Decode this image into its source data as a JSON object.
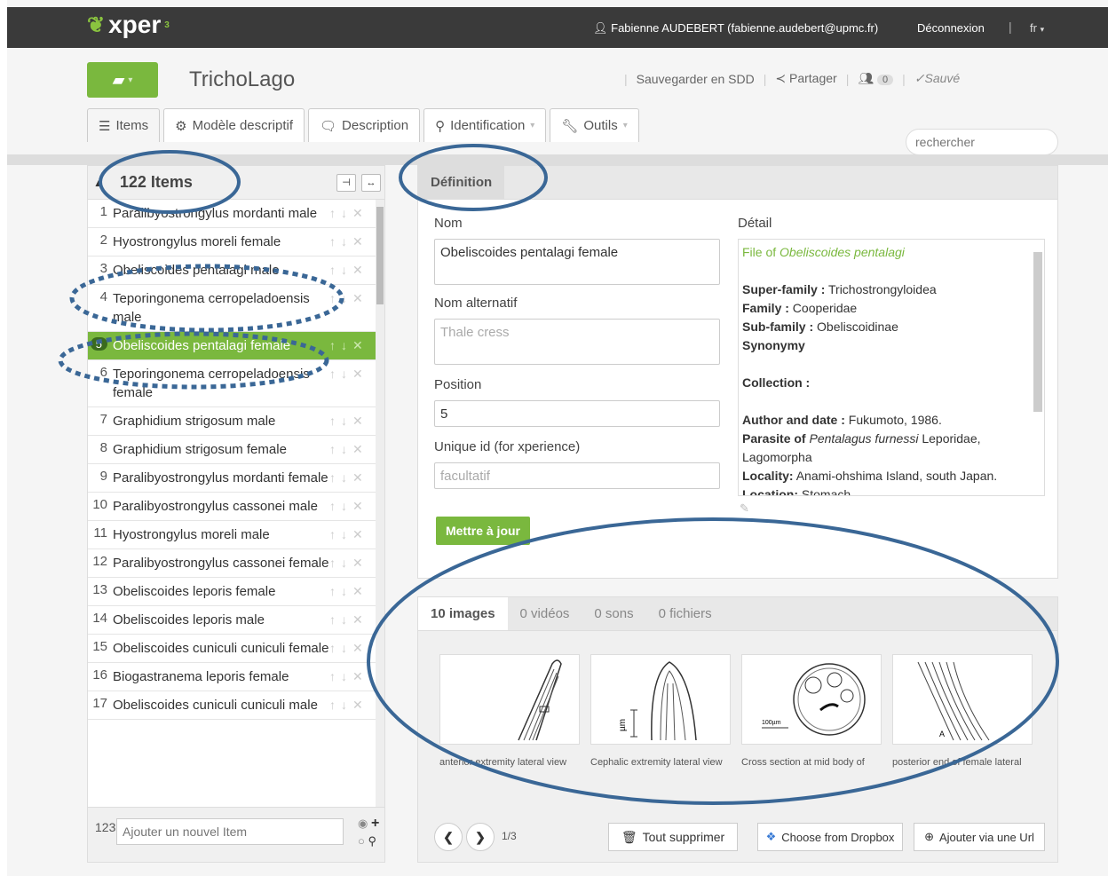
{
  "topbar": {
    "user": "Fabienne AUDEBERT (fabienne.audebert@upmc.fr)",
    "logout": "Déconnexion",
    "separator": "|",
    "lang": "fr"
  },
  "header": {
    "title": "TrichoLago",
    "save_sdd": "Sauvegarder en SDD",
    "share": "Partager",
    "collab_count": "0",
    "saved": "Sauvé"
  },
  "tabs": [
    "Items",
    "Modèle descriptif",
    "Description",
    "Identification",
    "Outils"
  ],
  "search": {
    "placeholder": "rechercher"
  },
  "items": {
    "count": "122 Items",
    "add_num": "123",
    "add_placeholder": "Ajouter un nouvel Item"
  },
  "item_rows": [
    {
      "num": "1",
      "name": "Paralibyostrongylus mordanti male"
    },
    {
      "num": "2",
      "name": "Hyostrongylus moreli female"
    },
    {
      "num": "3",
      "name": "Obeliscoides pentalagi male"
    },
    {
      "num": "4",
      "name": "Teporingonema cerropeladoensis male"
    },
    {
      "num": "5",
      "name": "Obeliscoides pentalagi female"
    },
    {
      "num": "6",
      "name": "Teporingonema cerropeladoensis female"
    },
    {
      "num": "7",
      "name": "Graphidium strigosum male"
    },
    {
      "num": "8",
      "name": "Graphidium strigosum female"
    },
    {
      "num": "9",
      "name": "Paralibyostrongylus mordanti female"
    },
    {
      "num": "10",
      "name": "Paralibyostrongylus cassonei male"
    },
    {
      "num": "11",
      "name": "Hyostrongylus moreli male"
    },
    {
      "num": "12",
      "name": "Paralibyostrongylus cassonei female"
    },
    {
      "num": "13",
      "name": "Obeliscoides leporis female"
    },
    {
      "num": "14",
      "name": "Obeliscoides leporis male"
    },
    {
      "num": "15",
      "name": "Obeliscoides cuniculi cuniculi female"
    },
    {
      "num": "16",
      "name": "Biogastranema leporis female"
    },
    {
      "num": "17",
      "name": "Obeliscoides cuniculi cuniculi male"
    }
  ],
  "definition": {
    "tab": "Définition",
    "nom_label": "Nom",
    "nom_value": "Obeliscoides pentalagi female",
    "alt_label": "Nom alternatif",
    "alt_placeholder": "Thale cress",
    "pos_label": "Position",
    "pos_value": "5",
    "uid_label": "Unique id (for xperience)",
    "uid_placeholder": "facultatif",
    "update": "Mettre à jour",
    "detail_label": "Détail",
    "detail": {
      "file_of": "File of ",
      "file_of_species": "Obeliscoides pentalagi",
      "superfamily_k": "Super-family :",
      "superfamily_v": " Trichostrongyloidea",
      "family_k": "Family :",
      "family_v": " Cooperidae",
      "subfamily_k": "Sub-family :",
      "subfamily_v": " Obeliscoidinae",
      "synonymy": "Synonymy",
      "collection": "Collection :",
      "author_k": "Author and date :",
      "author_v": " Fukumoto, 1986.",
      "parasite_k": "Parasite of ",
      "parasite_host": "Pentalagus furnessi",
      "parasite_v": " Leporidae, Lagomorpha",
      "locality_k": "Locality:",
      "locality_v": " Anami-ohshima Island, south Japan.",
      "location_k": "Location:",
      "location_v": " Stomach."
    }
  },
  "media": {
    "tabs": [
      "10 images",
      "0 vidéos",
      "0 sons",
      "0 fichiers"
    ],
    "captions": [
      "anterior extremity lateral view",
      "Cephalic extremity lateral view",
      "Cross section at mid body of",
      "posterior end of female lateral"
    ],
    "scale_label": "100µm",
    "page": "1/3",
    "delete_all": "Tout supprimer",
    "dropbox": "Choose from Dropbox",
    "add_url": "Ajouter via une Url"
  },
  "colors": {
    "accent": "#7ab83e",
    "topbar": "#3a3a3a",
    "annotation": "#3a6796"
  }
}
